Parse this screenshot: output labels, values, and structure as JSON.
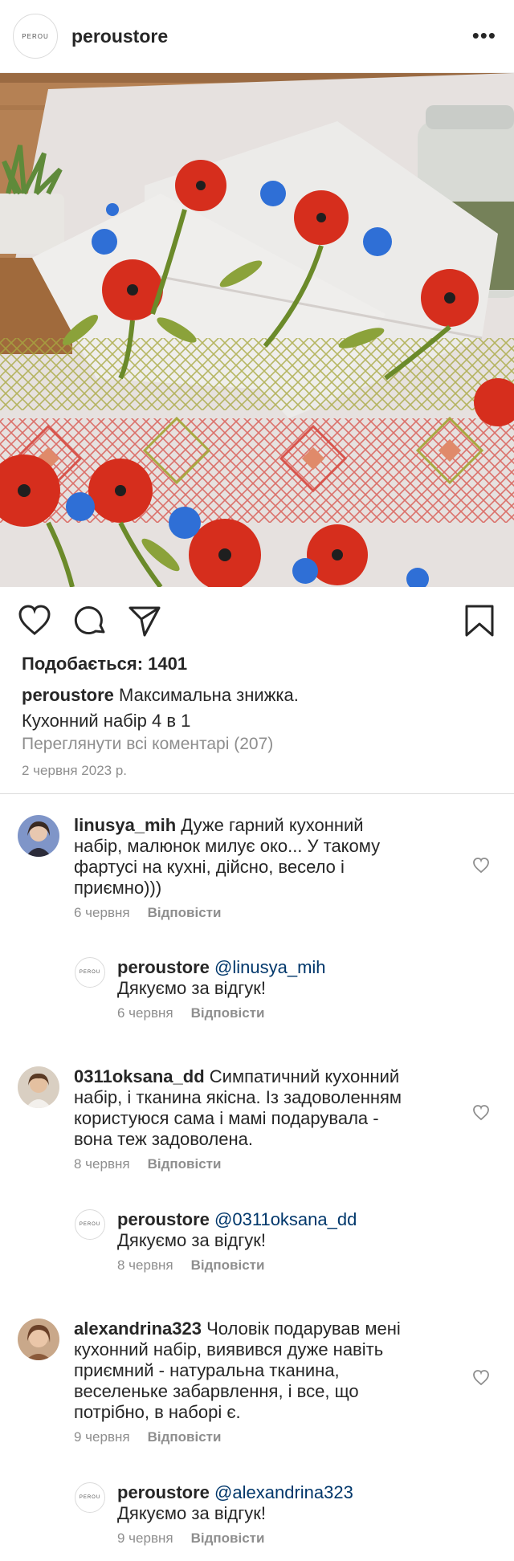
{
  "header": {
    "logo_text": "PEROU",
    "username": "peroustore",
    "more": "•••"
  },
  "post": {
    "likes": "Подобається: 1401",
    "caption_user": "peroustore",
    "caption_line1": "Максимальна знижка.",
    "caption_line2": "Кухонний набір 4 в 1",
    "view_all": "Переглянути всі коментарі (207)",
    "date": "2 червня 2023 р."
  },
  "comments": [
    {
      "user": "linusya_mih",
      "text_lines": [
        "Дуже гарний кухонний",
        "набір, малюнок милує око... У такому",
        "фартусі на кухні, дійсно, весело і",
        "приємно)))"
      ],
      "date": "6 червня",
      "reply": "Відповісти"
    },
    {
      "user": "peroustore",
      "mention": "@linusya_mih",
      "text": "Дякуємо за відгук!",
      "date": "6 червня",
      "reply": "Відповісти"
    },
    {
      "user": "0311oksana_dd",
      "text_lines": [
        "Симпатичний кухонний",
        "набір, і тканина якісна. Із задоволенням",
        "користуюся сама і мамі подарувала -",
        "вона теж задоволена."
      ],
      "date": "8 червня",
      "reply": "Відповісти"
    },
    {
      "user": "peroustore",
      "mention": "@0311oksana_dd",
      "text": "Дякуємо за відгук!",
      "date": "8 червня",
      "reply": "Відповісти"
    },
    {
      "user": "alexandrina323",
      "text_lines": [
        "Чоловік подарував мені",
        "кухонний набір, виявився дуже навіть",
        "приємний - натуральна тканина,",
        "веселеньке забарвлення, і все, що",
        "потрібно, в наборі є."
      ],
      "date": "9 червня",
      "reply": "Відповісти"
    },
    {
      "user": "peroustore",
      "mention": "@alexandrina323",
      "text": "Дякуємо за відгук!",
      "date": "9 червня",
      "reply": "Відповісти"
    }
  ]
}
